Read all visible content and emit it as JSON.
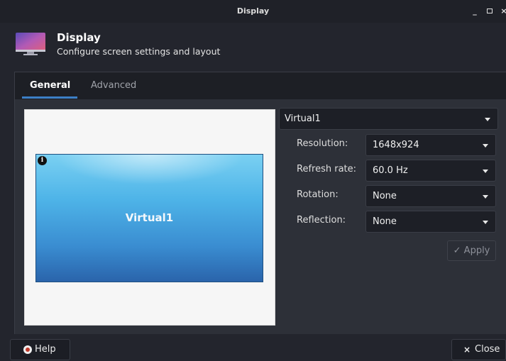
{
  "window": {
    "title": "Display",
    "minimize_glyph": "_",
    "close_glyph": "×"
  },
  "header": {
    "title": "Display",
    "subtitle": "Configure screen settings and layout",
    "icon": "display-settings-icon"
  },
  "tabs": [
    {
      "label": "General",
      "active": true
    },
    {
      "label": "Advanced",
      "active": false
    }
  ],
  "preview": {
    "monitor_label": "Virtual1",
    "info_glyph": "i"
  },
  "output_select": {
    "value": "Virtual1"
  },
  "settings": [
    {
      "label": "Resolution:",
      "value": "1648x924"
    },
    {
      "label": "Refresh rate:",
      "value": "60.0 Hz"
    },
    {
      "label": "Rotation:",
      "value": "None"
    },
    {
      "label": "Reflection:",
      "value": "None"
    }
  ],
  "apply_button": {
    "label": "Apply",
    "glyph": "✓",
    "enabled": false
  },
  "footer": {
    "help_label": "Help",
    "close_label": "Close",
    "close_glyph": "×"
  },
  "colors": {
    "accent": "#3c7fc6",
    "background": "#23252d"
  }
}
